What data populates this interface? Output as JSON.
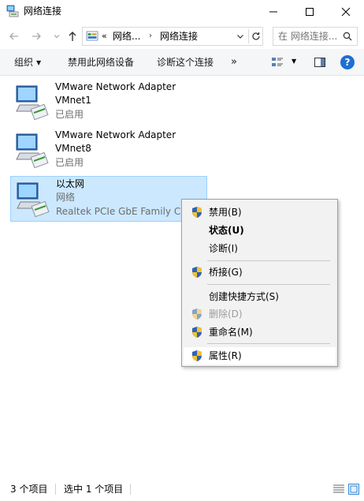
{
  "window": {
    "title": "网络连接",
    "minimize_icon": "minimize-icon",
    "maximize_icon": "maximize-icon",
    "close_icon": "close-icon"
  },
  "address_bar": {
    "overflow": "«",
    "crumb1": "网络...",
    "separator": "›",
    "crumb2": "网络连接",
    "search_placeholder": "在 网络连接...",
    "back_icon": "back-arrow-icon",
    "forward_icon": "forward-arrow-icon",
    "up_icon": "up-arrow-icon",
    "refresh_icon": "refresh-icon",
    "search_icon": "search-icon"
  },
  "command_bar": {
    "organize": "组织",
    "disable_device": "禁用此网络设备",
    "diagnose": "诊断这个连接",
    "more": "»",
    "help": "?"
  },
  "items": [
    {
      "line1": "VMware Network Adapter",
      "line2": "VMnet1",
      "line3": "已启用",
      "selected": false
    },
    {
      "line1": "VMware Network Adapter",
      "line2": "VMnet8",
      "line3": "已启用",
      "selected": false
    },
    {
      "line1": "以太网",
      "line2": "网络",
      "line3": "Realtek PCIe GbE Family Controller",
      "selected": true
    }
  ],
  "context_menu": {
    "items": [
      {
        "label": "禁用(B)",
        "shield": true,
        "bold": false,
        "disabled": false
      },
      {
        "label": "状态(U)",
        "shield": false,
        "bold": true,
        "disabled": false
      },
      {
        "label": "诊断(I)",
        "shield": false,
        "bold": false,
        "disabled": false
      },
      {
        "label": "桥接(G)",
        "shield": true,
        "bold": false,
        "disabled": false
      },
      {
        "label": "创建快捷方式(S)",
        "shield": false,
        "bold": false,
        "disabled": false
      },
      {
        "label": "删除(D)",
        "shield": true,
        "bold": false,
        "disabled": true
      },
      {
        "label": "重命名(M)",
        "shield": true,
        "bold": false,
        "disabled": false
      },
      {
        "label": "属性(R)",
        "shield": true,
        "bold": false,
        "disabled": false,
        "hover": true
      }
    ]
  },
  "status_bar": {
    "count": "3 个项目",
    "selected": "选中 1 个项目"
  },
  "colors": {
    "selection_bg": "#cce8ff",
    "selection_border": "#99d1ff",
    "menu_bg": "#f2f2f2",
    "help_blue": "#1f6fd1"
  }
}
